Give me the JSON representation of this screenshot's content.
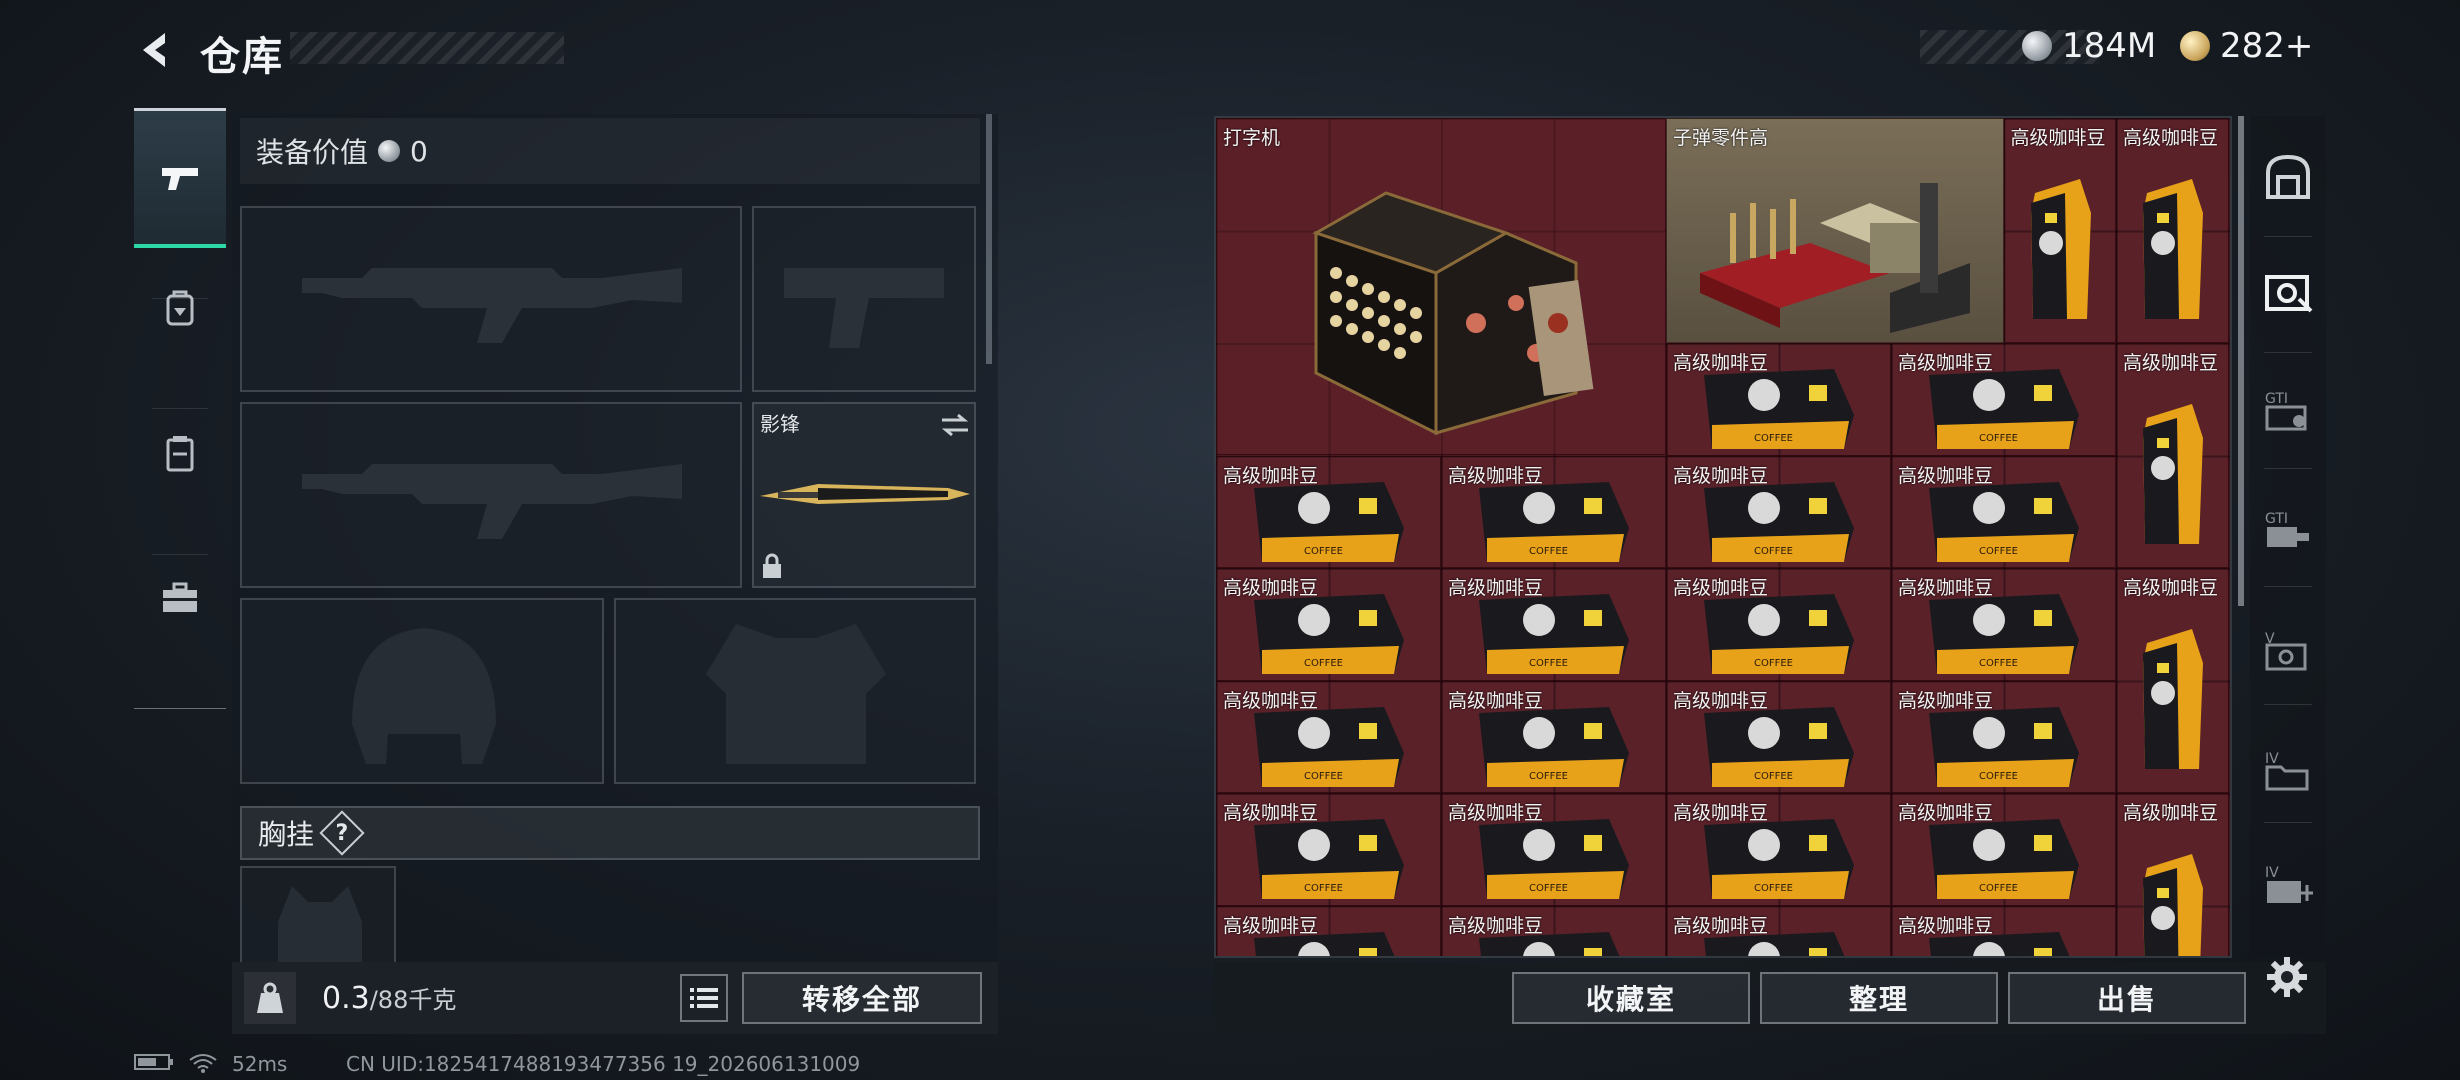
{
  "header": {
    "title": "仓库",
    "currencies": [
      {
        "icon": "silver-coin-icon",
        "value": "184M"
      },
      {
        "icon": "gold-coin-icon",
        "value": "282+"
      }
    ]
  },
  "sidenav": {
    "items": [
      {
        "name": "weapons",
        "icon": "pistol-icon",
        "active": true
      },
      {
        "name": "armor",
        "icon": "backpack-icon",
        "active": false
      },
      {
        "name": "gear",
        "icon": "vest-icon",
        "active": false
      },
      {
        "name": "toolbox",
        "icon": "toolbox-icon",
        "active": false
      }
    ]
  },
  "equipment": {
    "value_label": "装备价值",
    "value": "0",
    "melee_label": "影锋",
    "chest_rig_label": "胸挂",
    "help": "?"
  },
  "weight": {
    "current": "0.3",
    "max": "/88千克"
  },
  "buttons": {
    "transfer_all": "转移全部",
    "collection": "收藏室",
    "organize": "整理",
    "sell": "出售"
  },
  "storage": {
    "items": [
      {
        "name": "打字机",
        "art": "typewriter"
      },
      {
        "name": "子弹零件高",
        "art": "ammo-parts"
      },
      {
        "name": "高级咖啡豆",
        "art": "coffee-bag"
      }
    ]
  },
  "rightnav": {
    "items": [
      "safe-icon",
      "box-filter-icon",
      "gti-tool-icon",
      "gti-vehicle-icon",
      "v-box-icon",
      "iv-folder-icon",
      "iv-add-icon"
    ]
  },
  "status": {
    "ping": "52ms",
    "uid": "CN UID:1825417488193477356 19_202606131009"
  },
  "colors": {
    "accent": "#2ed8a4",
    "grid_bg": "#5a2129"
  }
}
